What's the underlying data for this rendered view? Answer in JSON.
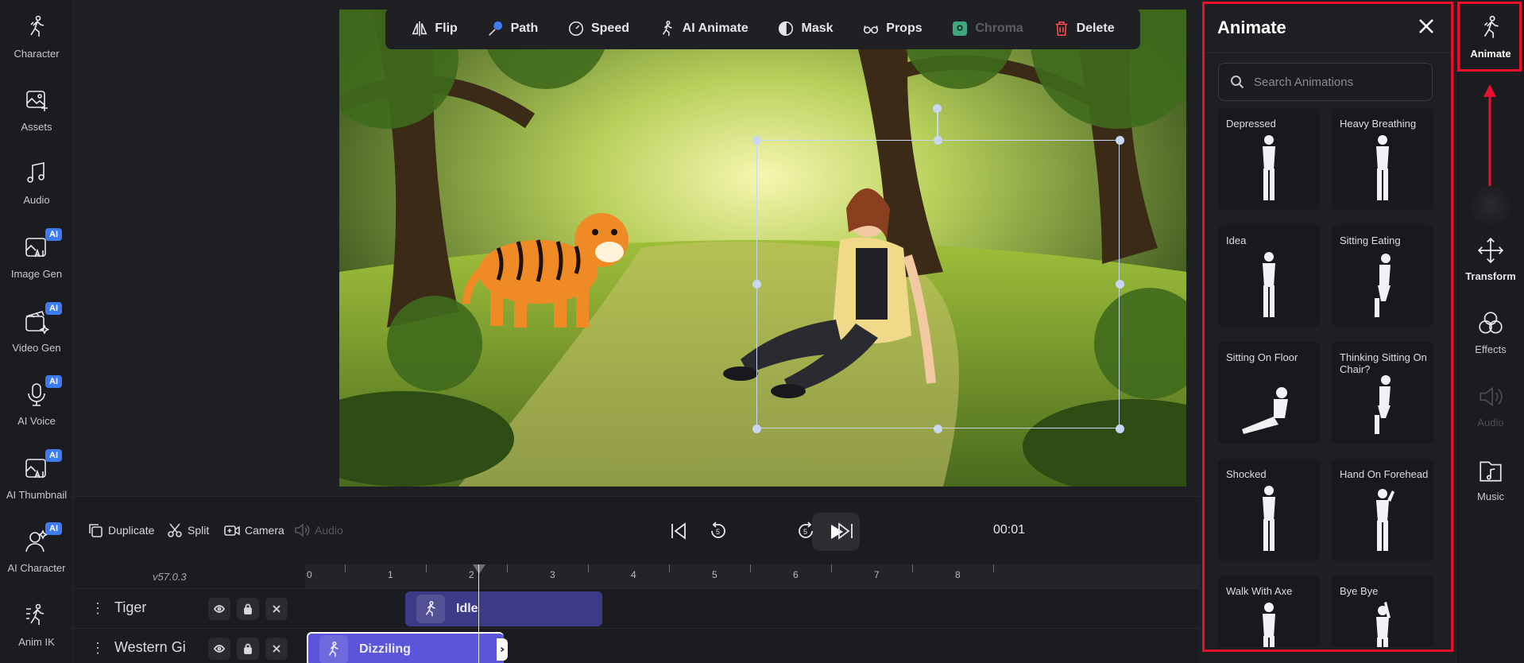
{
  "left_sidebar": {
    "items": [
      {
        "label": "Character",
        "icon": "run-figure-icon",
        "ai": false
      },
      {
        "label": "Assets",
        "icon": "image-add-icon",
        "ai": false
      },
      {
        "label": "Audio",
        "icon": "music-note-icon",
        "ai": false
      },
      {
        "label": "Image Gen",
        "icon": "image-ai-icon",
        "ai": true
      },
      {
        "label": "Video Gen",
        "icon": "clapper-icon",
        "ai": true
      },
      {
        "label": "AI Voice",
        "icon": "microphone-icon",
        "ai": true
      },
      {
        "label": "AI Thumbnail",
        "icon": "thumbnail-ai-icon",
        "ai": true
      },
      {
        "label": "AI Character",
        "icon": "person-ai-icon",
        "ai": true
      },
      {
        "label": "Anim IK",
        "icon": "ik-figure-icon",
        "ai": false
      }
    ],
    "ai_badge": "AI"
  },
  "toolbar": {
    "flip": "Flip",
    "path": "Path",
    "speed": "Speed",
    "ai_animate": "AI Animate",
    "mask": "Mask",
    "props": "Props",
    "chroma": "Chroma",
    "delete": "Delete"
  },
  "playbar": {
    "duplicate": "Duplicate",
    "split": "Split",
    "camera": "Camera",
    "audio": "Audio",
    "rewind_seconds": "5",
    "forward_seconds": "5",
    "time": "00:01"
  },
  "timeline": {
    "version": "v57.0.3",
    "ticks": [
      "0",
      "1",
      "2",
      "3",
      "4",
      "5",
      "6",
      "7",
      "8"
    ],
    "tracks": [
      {
        "name": "Tiger",
        "clip": "Idle"
      },
      {
        "name": "Western Gi",
        "clip": "Dizziling"
      }
    ]
  },
  "animate_panel": {
    "title": "Animate",
    "search_placeholder": "Search Animations",
    "animations": [
      "Depressed",
      "Heavy Breathing",
      "Idea",
      "Sitting Eating",
      "Sitting On Floor",
      "Thinking Sitting On Chair?",
      "Shocked",
      "Hand On Forehead",
      "Walk With Axe",
      "Bye Bye"
    ]
  },
  "right_rail": {
    "items": [
      {
        "label": "Animate",
        "icon": "run-figure-icon",
        "active": true,
        "disabled": false
      },
      {
        "label": "Transform",
        "icon": "move-arrows-icon",
        "active": false,
        "disabled": false
      },
      {
        "label": "Effects",
        "icon": "circles-icon",
        "active": false,
        "disabled": false
      },
      {
        "label": "Audio",
        "icon": "speaker-icon",
        "active": false,
        "disabled": true
      },
      {
        "label": "Music",
        "icon": "music-file-icon",
        "active": false,
        "disabled": false
      }
    ]
  },
  "colors": {
    "highlight": "#e8112d",
    "accent": "#3f7bf0",
    "clip_idle": "#3d3a87",
    "clip_active": "#5b56d9"
  }
}
